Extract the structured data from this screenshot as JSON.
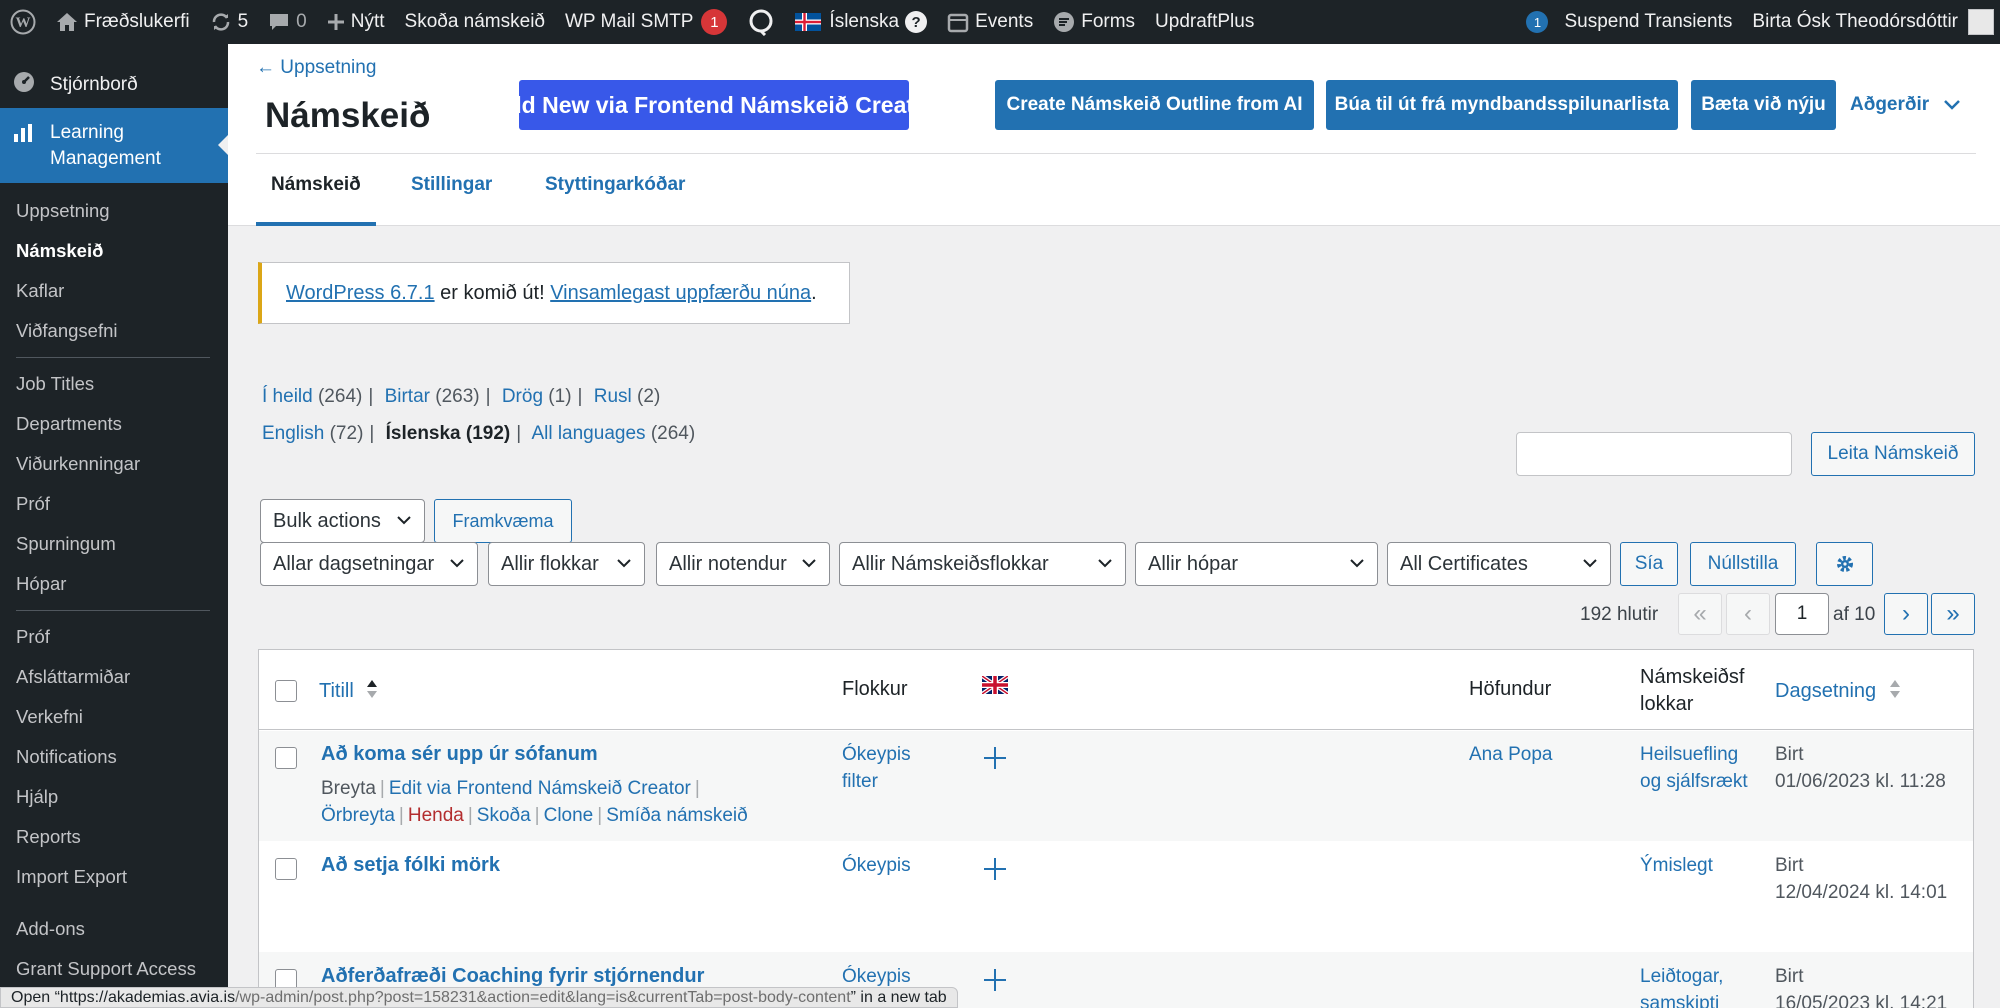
{
  "adminbar": {
    "site_name": "Fræðslukerfi",
    "updates_count": "5",
    "comments_count": "0",
    "new_label": "Nýtt",
    "view_courses": "Skoða námskeið",
    "wp_mail": "WP Mail SMTP",
    "wp_mail_badge": "1",
    "language": "Íslenska",
    "events": "Events",
    "forms": "Forms",
    "updraft": "UpdraftPlus",
    "transients_badge": "1",
    "suspend_transients": "Suspend Transients",
    "user_name": "Birta Ósk Theodórsdóttir"
  },
  "sidebar": {
    "dashboard": "Stjórnborð",
    "active_menu": "Learning Management",
    "items": [
      "Uppsetning",
      "Námskeið",
      "Kaflar",
      "Viðfangsefni"
    ],
    "items2": [
      "Job Titles",
      "Departments",
      "Viðurkenningar",
      "Próf",
      "Spurningum",
      "Hópar"
    ],
    "items3": [
      "Próf",
      "Afsláttarmiðar",
      "Verkefni",
      "Notifications",
      "Hjálp",
      "Reports",
      "Import Export"
    ],
    "items4": [
      "Add-ons",
      "Grant Support Access"
    ]
  },
  "header": {
    "back_link": "← Uppsetning",
    "title": "Námskeið",
    "btn_frontend": "Add New via Frontend Námskeið Creator",
    "btn_ai": "Create Námskeið Outline from AI",
    "btn_playlist": "Búa til út frá myndbandsspilunarlista",
    "btn_add": "Bæta við nýju",
    "actions": "Aðgerðir",
    "tabs": [
      "Námskeið",
      "Stillingar",
      "Styttingarkóðar"
    ]
  },
  "notice": {
    "link1": "WordPress 6.7.1",
    "text": " er komið út! ",
    "link2": "Vinsamlegast uppfærðu núna",
    "end": "."
  },
  "filters_status": {
    "all": "Í heild",
    "all_count": "(264)",
    "published": "Birtar",
    "published_count": "(263)",
    "draft": "Drög",
    "draft_count": "(1)",
    "trash": "Rusl",
    "trash_count": "(2)"
  },
  "filters_lang": {
    "english": "English",
    "english_count": "(72)",
    "icelandic": "Íslenska (192)",
    "all": "All languages",
    "all_count": "(264)"
  },
  "search": {
    "button": "Leita Námskeið"
  },
  "bulk": {
    "select": "Bulk actions",
    "apply": "Framkvæma"
  },
  "filter_selects": [
    "Allar dagsetningar",
    "Allir flokkar",
    "Allir notendur",
    "Allir Námskeiðsflokkar",
    "Allir hópar",
    "All Certificates"
  ],
  "filter_buttons": {
    "filter": "Sía",
    "reset": "Núllstilla"
  },
  "pagination": {
    "count": "192 hlutir",
    "first": "«",
    "prev": "‹",
    "current": "1",
    "of": "af 10",
    "next": "›",
    "last": "»"
  },
  "table": {
    "headers": {
      "title": "Titill",
      "category": "Flokkur",
      "author": "Höfundur",
      "course_cats": "Námskeiðsf lokkar",
      "date": "Dagsetning"
    },
    "rows": [
      {
        "title": "Að koma sér upp úr sófanum",
        "category": "Ókeypis filter",
        "author": "Ana Popa",
        "course_cat": "Heilsuefling og sjálfsrækt",
        "status": "Birt",
        "date": "01/06/2023 kl. 11:28",
        "actions": {
          "edit": "Breyta",
          "frontend": "Edit via Frontend Námskeið Creator",
          "quick": "Örbreyta",
          "trash": "Henda",
          "view": "Skoða",
          "clone": "Clone",
          "build": "Smíða námskeið"
        }
      },
      {
        "title": "Að setja fólki mörk",
        "category": "Ókeypis",
        "author": "",
        "course_cat": "Ýmislegt",
        "status": "Birt",
        "date": "12/04/2024 kl. 14:01"
      },
      {
        "title": "Aðferðafræði Coaching fyrir stjórnendur",
        "category": "Ókeypis",
        "author": "",
        "course_cat": "Leiðtogar, samskipti",
        "status": "Birt",
        "date": "16/05/2023 kl. 14:21"
      }
    ]
  },
  "statusbar": {
    "prefix": "Open “https://akademias.avia.is",
    "url": "/wp-admin/post.php?post=158231&action=edit&lang=is&currentTab=post-body-content",
    "suffix": "” in a new tab"
  }
}
